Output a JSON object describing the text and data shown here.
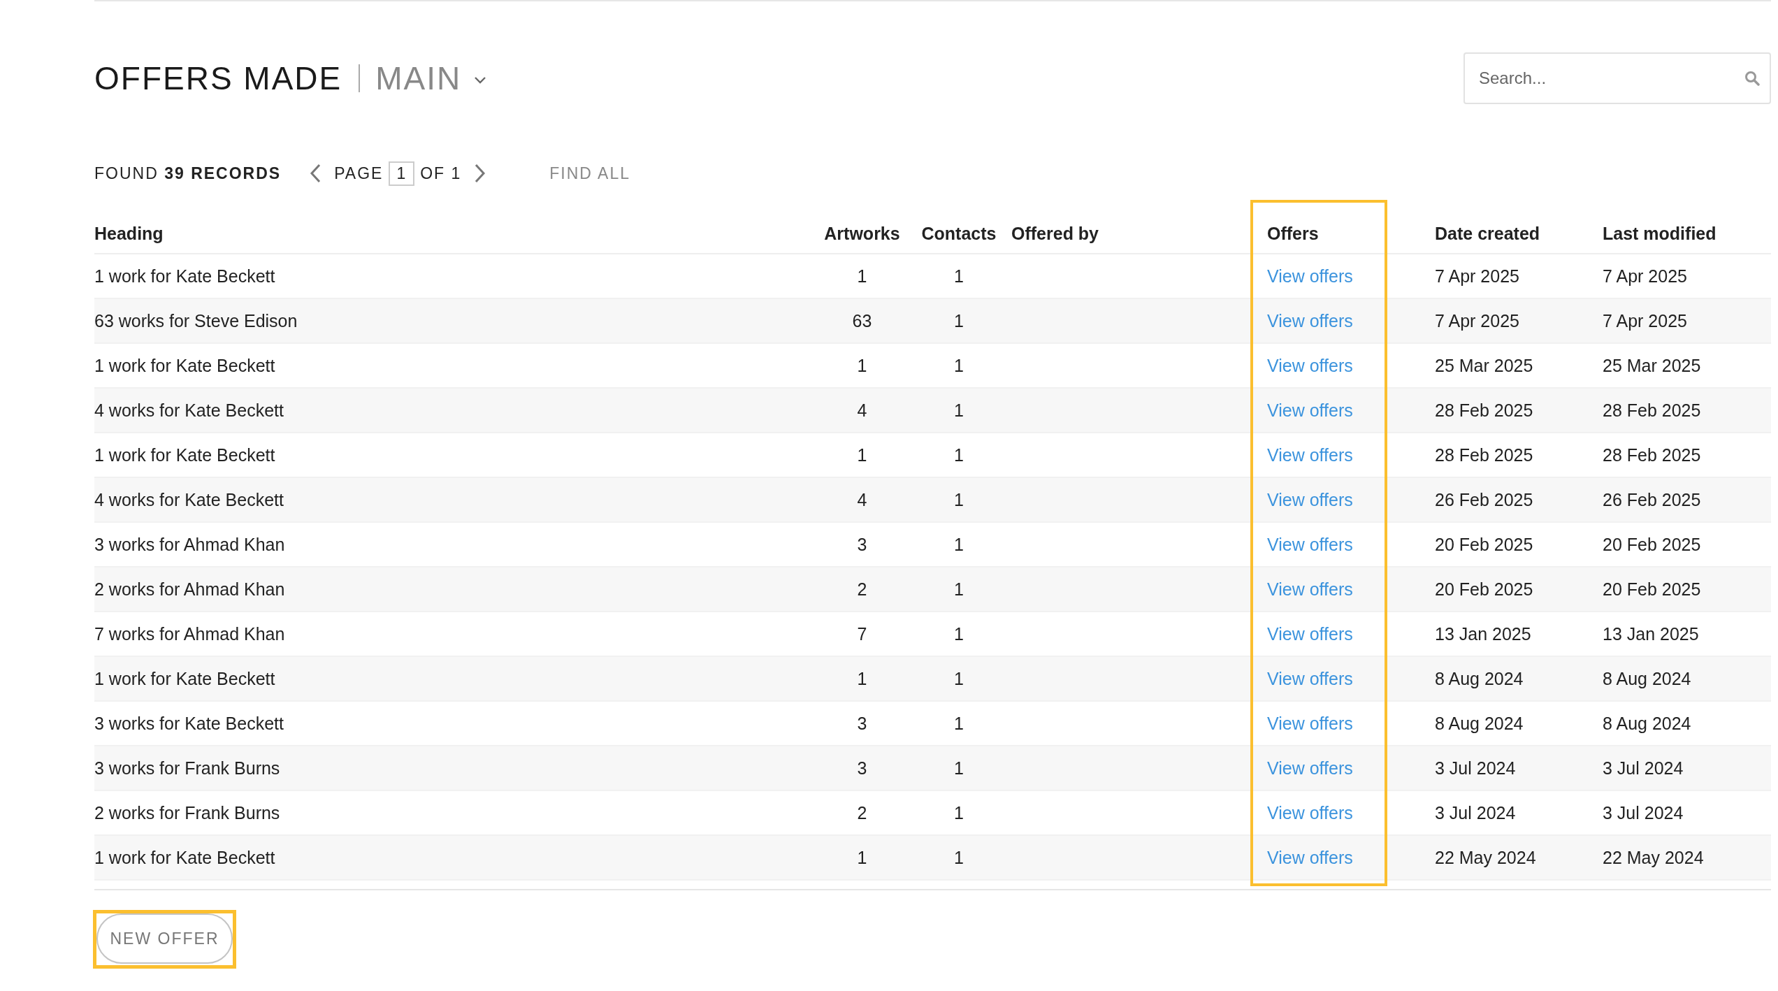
{
  "header": {
    "title": "OFFERS MADE",
    "view": "MAIN"
  },
  "search": {
    "placeholder": "Search..."
  },
  "pagination": {
    "found": "FOUND **39 RECORDS**",
    "page_label": "PAGE",
    "page": "1",
    "of": "OF 1",
    "find_all": "FIND ALL"
  },
  "table": {
    "columns": [
      "Heading",
      "Artworks",
      "Contacts",
      "Offered by",
      "Offers",
      "Date created",
      "Last modified"
    ],
    "rows": [
      {
        "heading": "1 work for Kate Beckett",
        "artworks": "1",
        "contacts": "1",
        "offers": "View offers",
        "date_created": "7 Apr 2025",
        "last_modified": "7 Apr 2025"
      },
      {
        "heading": "63 works for Steve Edison",
        "artworks": "63",
        "contacts": "1",
        "offers": "View offers",
        "date_created": "7 Apr 2025",
        "last_modified": "7 Apr 2025"
      },
      {
        "heading": "1 work for Kate Beckett",
        "artworks": "1",
        "contacts": "1",
        "offers": "View offers",
        "date_created": "25 Mar 2025",
        "last_modified": "25 Mar 2025"
      },
      {
        "heading": "4 works for Kate Beckett",
        "artworks": "4",
        "contacts": "1",
        "offers": "View offers",
        "date_created": "28 Feb 2025",
        "last_modified": "28 Feb 2025"
      },
      {
        "heading": "1 work for Kate Beckett",
        "artworks": "1",
        "contacts": "1",
        "offers": "View offers",
        "date_created": "28 Feb 2025",
        "last_modified": "28 Feb 2025"
      },
      {
        "heading": "4 works for Kate Beckett",
        "artworks": "4",
        "contacts": "1",
        "offers": "View offers",
        "date_created": "26 Feb 2025",
        "last_modified": "26 Feb 2025"
      },
      {
        "heading": "3 works for Ahmad Khan",
        "artworks": "3",
        "contacts": "1",
        "offers": "View offers",
        "date_created": "20 Feb 2025",
        "last_modified": "20 Feb 2025"
      },
      {
        "heading": "2 works for Ahmad Khan",
        "artworks": "2",
        "contacts": "1",
        "offers": "View offers",
        "date_created": "20 Feb 2025",
        "last_modified": "20 Feb 2025"
      },
      {
        "heading": "7 works for Ahmad Khan",
        "artworks": "7",
        "contacts": "1",
        "offers": "View offers",
        "date_created": "13 Jan 2025",
        "last_modified": "13 Jan 2025"
      },
      {
        "heading": "1 work for Kate Beckett",
        "artworks": "1",
        "contacts": "1",
        "offers": "View offers",
        "date_created": "8 Aug 2024",
        "last_modified": "8 Aug 2024"
      },
      {
        "heading": "3 works for Kate Beckett",
        "artworks": "3",
        "contacts": "1",
        "offers": "View offers",
        "date_created": "8 Aug 2024",
        "last_modified": "8 Aug 2024"
      },
      {
        "heading": "3 works for Frank Burns",
        "artworks": "3",
        "contacts": "1",
        "offers": "View offers",
        "date_created": "3 Jul 2024",
        "last_modified": "3 Jul 2024"
      },
      {
        "heading": "2 works for Frank Burns",
        "artworks": "2",
        "contacts": "1",
        "offers": "View offers",
        "date_created": "3 Jul 2024",
        "last_modified": "3 Jul 2024"
      },
      {
        "heading": "1 work for Kate Beckett",
        "artworks": "1",
        "contacts": "1",
        "offers": "View offers",
        "date_created": "22 May 2024",
        "last_modified": "22 May 2024"
      }
    ]
  },
  "new_offer_button": "NEW OFFER"
}
